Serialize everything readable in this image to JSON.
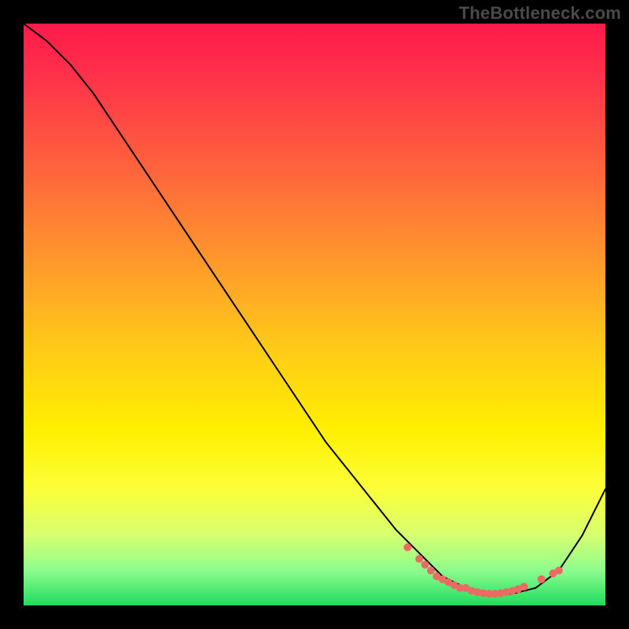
{
  "watermark": "TheBottleneck.com",
  "chart_data": {
    "type": "line",
    "title": "",
    "xlabel": "",
    "ylabel": "",
    "xlim": [
      0,
      100
    ],
    "ylim": [
      0,
      100
    ],
    "grid": false,
    "series": [
      {
        "name": "bottleneck-curve",
        "x": [
          0,
          4,
          8,
          12,
          16,
          20,
          24,
          28,
          32,
          36,
          40,
          44,
          48,
          52,
          56,
          60,
          64,
          68,
          72,
          76,
          80,
          84,
          88,
          92,
          96,
          100
        ],
        "values": [
          100,
          97,
          93,
          88,
          82,
          76,
          70,
          64,
          58,
          52,
          46,
          40,
          34,
          28,
          23,
          18,
          13,
          9,
          5,
          3,
          2,
          2,
          3,
          6,
          12,
          20
        ]
      }
    ],
    "markers": {
      "name": "highlight-range",
      "x": [
        66,
        68,
        69,
        70,
        71,
        72,
        73,
        74,
        75,
        76,
        77,
        78,
        79,
        80,
        81,
        82,
        83,
        84,
        85,
        86,
        89,
        91,
        92
      ],
      "values": [
        10,
        8,
        7,
        6,
        5,
        4.5,
        4,
        3.5,
        3,
        3,
        2.5,
        2.3,
        2.1,
        2,
        2,
        2.1,
        2.3,
        2.5,
        2.8,
        3.2,
        4.5,
        5.5,
        6
      ]
    },
    "background_gradient": {
      "stops": [
        {
          "pct": 0,
          "color": "#ff1a4b"
        },
        {
          "pct": 8,
          "color": "#ff2e4a"
        },
        {
          "pct": 22,
          "color": "#ff5a3f"
        },
        {
          "pct": 38,
          "color": "#ff8f2f"
        },
        {
          "pct": 55,
          "color": "#ffc819"
        },
        {
          "pct": 70,
          "color": "#fff000"
        },
        {
          "pct": 80,
          "color": "#fbff3a"
        },
        {
          "pct": 88,
          "color": "#d6ff70"
        },
        {
          "pct": 94,
          "color": "#8dfd8d"
        },
        {
          "pct": 100,
          "color": "#1edc5d"
        }
      ]
    }
  }
}
